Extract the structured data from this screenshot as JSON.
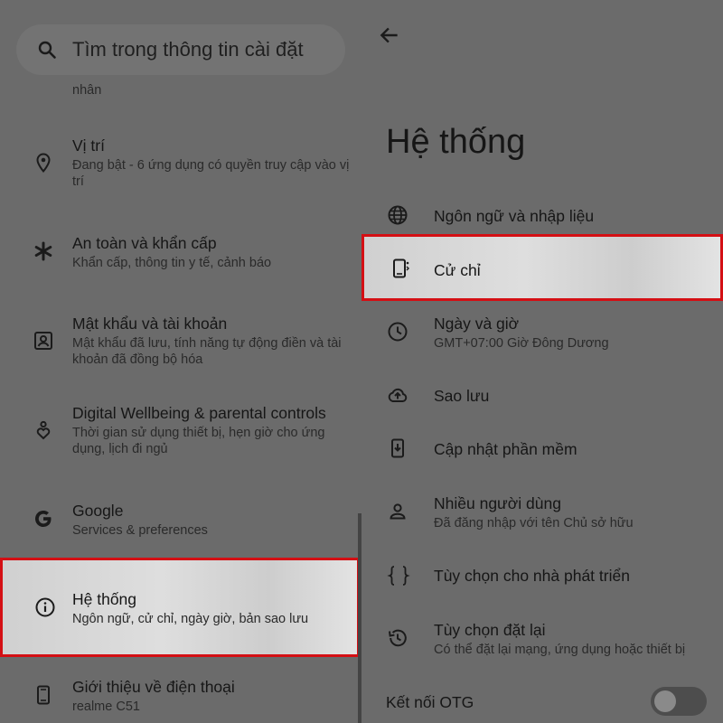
{
  "left": {
    "search_placeholder": "Tìm trong thông tin cài đặt",
    "cut_off_text": "nhân",
    "items": [
      {
        "title": "Vị trí",
        "subtitle": "Đang bật - 6 ứng dụng có quyền truy cập vào vị trí",
        "icon": "location-pin-icon"
      },
      {
        "title": "An toàn và khẩn cấp",
        "subtitle": "Khẩn cấp, thông tin y tế, cảnh báo",
        "icon": "asterisk-icon"
      },
      {
        "title": "Mật khẩu và tài khoản",
        "subtitle": "Mật khẩu đã lưu, tính năng tự động điền và tài khoản đã đồng bộ hóa",
        "icon": "account-box-icon"
      },
      {
        "title": "Digital Wellbeing & parental controls",
        "subtitle": "Thời gian sử dụng thiết bị, hẹn giờ cho ứng dụng, lịch đi ngủ",
        "icon": "wellbeing-icon"
      },
      {
        "title": "Google",
        "subtitle": "Services & preferences",
        "icon": "google-icon"
      },
      {
        "title": "Hệ thống",
        "subtitle": "Ngôn ngữ, cử chỉ, ngày giờ, bản sao lưu",
        "icon": "info-icon",
        "highlighted": true
      },
      {
        "title": "Giới thiệu về điện thoại",
        "subtitle": "realme C51",
        "icon": "phone-icon"
      }
    ]
  },
  "right": {
    "title": "Hệ thống",
    "items": [
      {
        "title": "Ngôn ngữ và nhập liệu",
        "icon": "globe-icon"
      },
      {
        "title": "Cử chỉ",
        "icon": "gesture-phone-icon",
        "highlighted": true
      },
      {
        "title": "Ngày và giờ",
        "subtitle": "GMT+07:00 Giờ Đông Dương",
        "icon": "clock-icon"
      },
      {
        "title": "Sao lưu",
        "icon": "cloud-upload-icon"
      },
      {
        "title": "Cập nhật phần mềm",
        "icon": "system-update-icon"
      },
      {
        "title": "Nhiều người dùng",
        "subtitle": "Đã đăng nhập với tên Chủ sở hữu",
        "icon": "person-icon"
      },
      {
        "title": "Tùy chọn cho nhà phát triển",
        "icon": "braces-icon"
      },
      {
        "title": "Tùy chọn đặt lại",
        "subtitle": "Có thể đặt lại mạng, ứng dụng hoặc thiết bị",
        "icon": "history-icon"
      }
    ],
    "otg": {
      "label": "Kết nối OTG",
      "enabled": false
    }
  },
  "colors": {
    "highlight_border": "#d40f14",
    "dim_background": "#6b6b6b"
  }
}
